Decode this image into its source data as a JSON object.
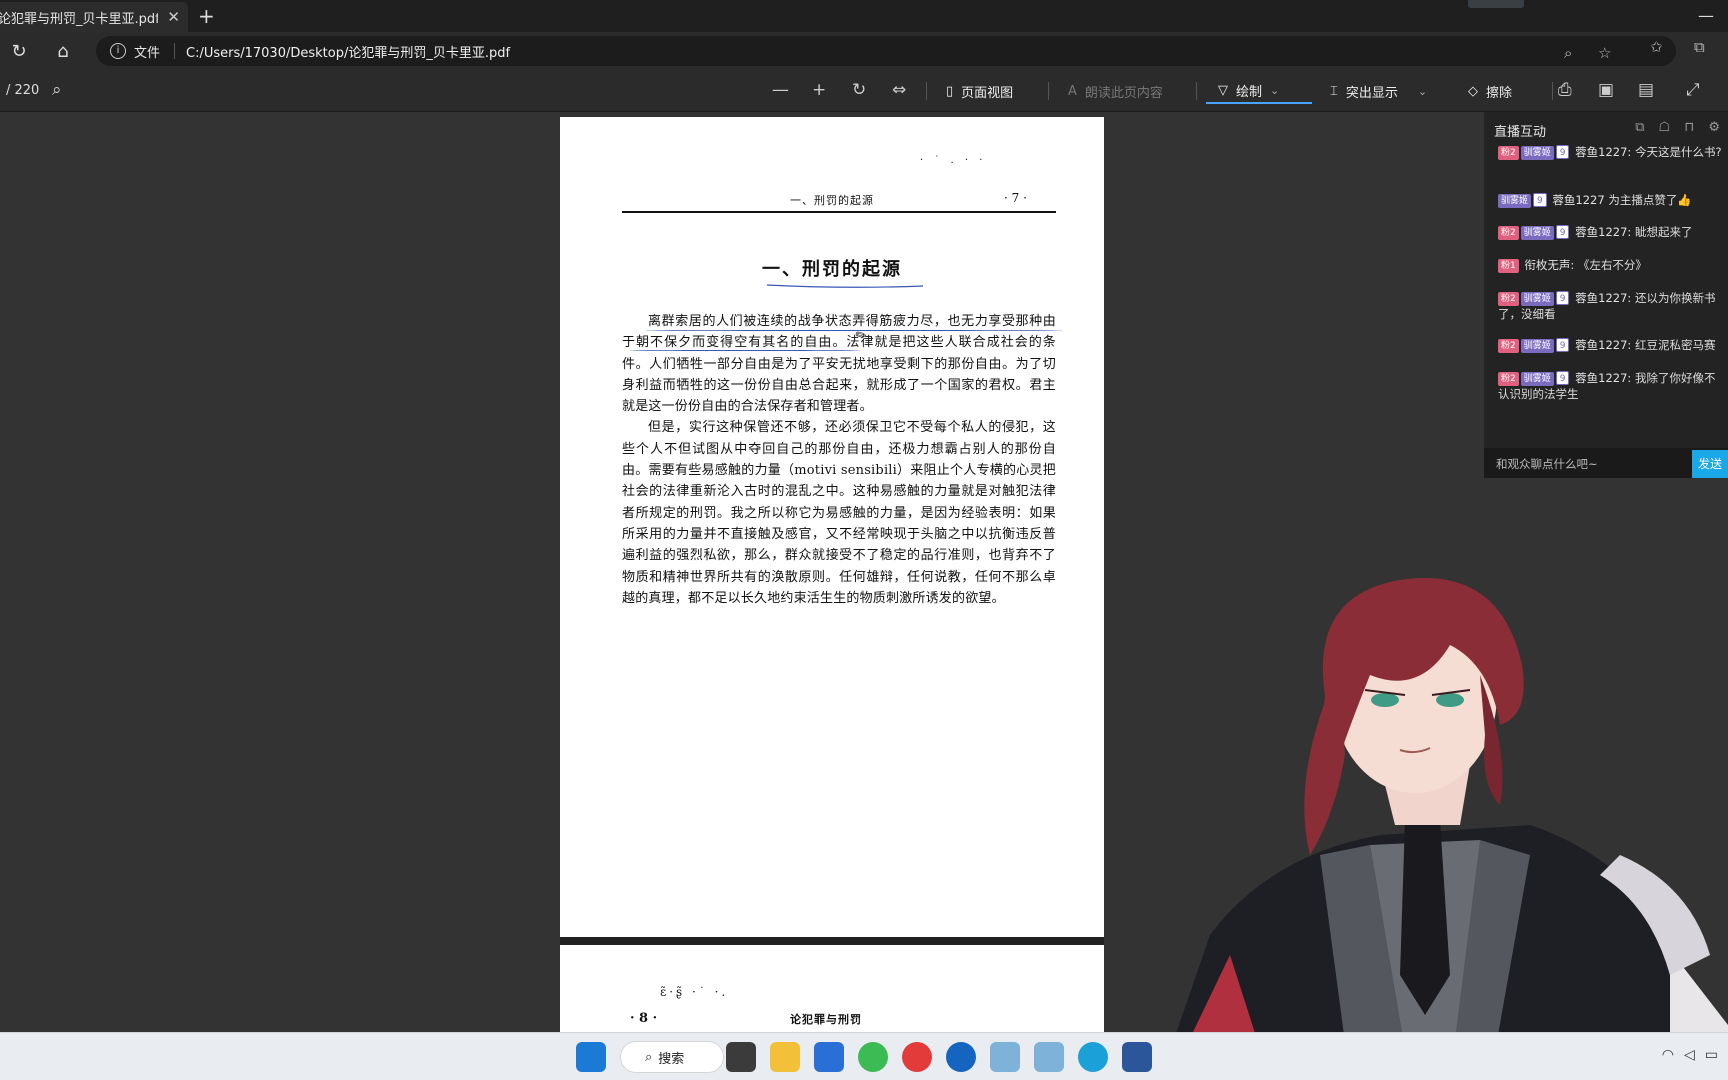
{
  "browser": {
    "tab_title": "论犯罪与刑罚_贝卡里亚.pdf",
    "tab_close": "✕",
    "new_tab": "+",
    "file_label": "文件",
    "url": "C:/Users/17030/Desktop/论犯罪与刑罚_贝卡里亚.pdf"
  },
  "pdf_toolbar": {
    "page_count": "/ 220",
    "page_view": "页面视图",
    "read_aloud": "朗读此页内容",
    "draw": "绘制",
    "highlight": "突出显示",
    "erase": "擦除"
  },
  "document": {
    "page1": {
      "running_head": "一、刑罚的起源",
      "page_number": "· 7 ·",
      "scan_marks": "· ˙ . · ·",
      "chapter_title": "一、刑罚的起源",
      "paragraphs": [
        "离群索居的人们被连续的战争状态弄得筋疲力尽，也无力享受那种由于朝不保夕而变得空有其名的自由。法律就是把这些人联合成社会的条件。人们牺牲一部分自由是为了平安无扰地享受剩下的那份自由。为了切身利益而牺牲的这一份份自由总合起来，就形成了一个国家的君权。君主就是这一份份自由的合法保存者和管理者。",
        "但是，实行这种保管还不够，还必须保卫它不受每个私人的侵犯，这些个人不但试图从中夺回自己的那份自由，还极力想霸占别人的那份自由。需要有些易感触的力量（motivi sensibili）来阻止个人专横的心灵把社会的法律重新沦入古时的混乱之中。这种易感触的力量就是对触犯法律者所规定的刑罚。我之所以称它为易感触的力量，是因为经验表明：如果所采用的力量并不直接触及感官，又不经常映现于头脑之中以抗衡违反普遍利益的强烈私欲，那么，群众就接受不了稳定的品行准则，也背弃不了物质和精神世界所共有的涣散原则。任何雄辩，任何说教，任何不那么卓越的真理，都不足以长久地约束活生生的物质刺激所诱发的欲望。"
      ]
    },
    "page2": {
      "page_number": "· 8 ·",
      "running_head": "论犯罪与刑罚",
      "scan_marks": "ɛ̃·ʂ̃ ·˙ ·."
    }
  },
  "chat": {
    "title": "直播互动",
    "messages": [
      {
        "badges": [
          "粉2",
          "驯雾姬",
          "9"
        ],
        "user": "蓉鱼1227:",
        "text": "今天这是什么书?"
      },
      {
        "badges": [
          "驯雾姬",
          "9"
        ],
        "user": "蓉鱼1227",
        "text": "为主播点赞了👍"
      },
      {
        "badges": [
          "粉2",
          "驯雾姬",
          "9"
        ],
        "user": "蓉鱼1227:",
        "text": "眦想起来了"
      },
      {
        "badges": [
          "粉1"
        ],
        "user": "衔枚无声:",
        "text": "《左右不分》"
      },
      {
        "badges": [
          "粉2",
          "驯雾姬",
          "9"
        ],
        "user": "蓉鱼1227:",
        "text": "还以为你换新书了，没细看"
      },
      {
        "badges": [
          "粉2",
          "驯雾姬",
          "9"
        ],
        "user": "蓉鱼1227:",
        "text": "红豆泥私密马赛"
      },
      {
        "badges": [
          "粉2",
          "驯雾姬",
          "9"
        ],
        "user": "蓉鱼1227:",
        "text": "我除了你好像不认识别的法学生"
      }
    ],
    "input_placeholder": "和观众聊点什么吧~",
    "send_label": "发送"
  },
  "taskbar": {
    "search_label": "搜索"
  },
  "colors": {
    "accent_blue": "#4aa3ff",
    "ink_annotation": "#3856b8",
    "send_button": "#1aa8e8"
  }
}
